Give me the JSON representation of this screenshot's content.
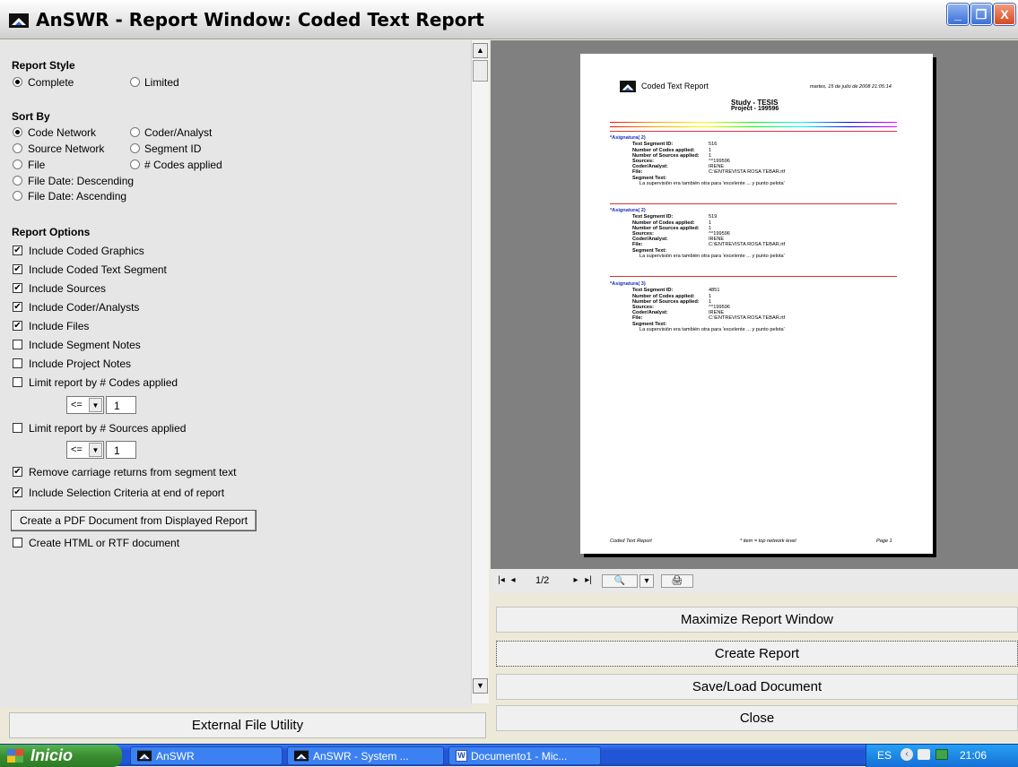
{
  "window": {
    "title": "AnSWR - Report Window:  Coded Text Report",
    "min_glyph": "_",
    "max_glyph": "❐",
    "close_glyph": "X"
  },
  "report_style": {
    "label": "Report Style",
    "options": [
      {
        "label": "Complete",
        "selected": true
      },
      {
        "label": "Limited",
        "selected": false
      }
    ]
  },
  "sort_by": {
    "label": "Sort By",
    "options": [
      {
        "label": "Code Network",
        "selected": true
      },
      {
        "label": "Coder/Analyst",
        "selected": false
      },
      {
        "label": "Source Network",
        "selected": false
      },
      {
        "label": "Segment ID",
        "selected": false
      },
      {
        "label": "File",
        "selected": false
      },
      {
        "label": "# Codes applied",
        "selected": false
      },
      {
        "label": "File Date: Descending",
        "selected": false
      },
      {
        "label": "File Date: Ascending",
        "selected": false
      }
    ]
  },
  "report_options": {
    "label": "Report Options",
    "checkboxes": [
      {
        "label": "Include Coded Graphics",
        "checked": true
      },
      {
        "label": "Include Coded Text Segment",
        "checked": true
      },
      {
        "label": "Include Sources",
        "checked": true
      },
      {
        "label": "Include Coder/Analysts",
        "checked": true
      },
      {
        "label": "Include Files",
        "checked": true
      },
      {
        "label": "Include Segment Notes",
        "checked": false
      },
      {
        "label": "Include Project Notes",
        "checked": false
      },
      {
        "label": "Limit report by # Codes applied",
        "checked": false
      },
      {
        "label": "Limit report by # Sources applied",
        "checked": false
      },
      {
        "label": "Remove carriage returns from segment text",
        "checked": true
      },
      {
        "label": "Include Selection Criteria at end of report",
        "checked": true
      },
      {
        "label": "Create HTML or RTF document",
        "checked": false
      }
    ],
    "codes_limit": {
      "operator": "<=",
      "value": "1"
    },
    "sources_limit": {
      "operator": "<=",
      "value": "1"
    },
    "pdf_button": "Create a PDF Document from Displayed Report",
    "check_glyph": "✔"
  },
  "external_button": "External File Utility",
  "preview": {
    "header_title": "Coded Text Report",
    "header_date": "martes, 15 de julio de 2008  21:05:14",
    "study": "Study - TESIS",
    "project": "Project - 199596",
    "entries": [
      {
        "code": "*Asignatura( 2)",
        "segment_id": "516",
        "codes": "1",
        "sources": "1",
        "source": "^^199596",
        "coder": "IRENE",
        "file": "C:\\ENTREVISTA ROSA TEBAR.rtf",
        "text": "La supervisión era también otra para 'excelente ... y punto pelota'"
      },
      {
        "code": "*Asignatura( 2)",
        "segment_id": "519",
        "codes": "1",
        "sources": "1",
        "source": "^^199596",
        "coder": "IRENE",
        "file": "C:\\ENTREVISTA ROSA TEBAR.rtf",
        "text": "La supervisión era también otra para 'excelente ... y punto pelota'"
      },
      {
        "code": "*Asignatura( 3)",
        "segment_id": "4851",
        "codes": "1",
        "sources": "1",
        "source": "^^199596",
        "coder": "IRENE",
        "file": "C:\\ENTREVISTA ROSA TEBAR.rtf",
        "text": "La supervisión era también otra para 'excelente ... y punto pelota'"
      }
    ],
    "field_labels": {
      "segment_id": "Text Segment ID:",
      "codes": "Number of Codes applied:",
      "sources": "Number of Sources applied:",
      "source": "Sources:",
      "coder": "Coder/Analyst:",
      "file": "File:",
      "text": "Segment Text:"
    },
    "footer_left": "Coded Text Report",
    "footer_mid": "* item = top network level",
    "footer_right": "Page 1"
  },
  "nav": {
    "page": "1/2",
    "first": "|◂",
    "prev": "◂",
    "next": "▸",
    "last": "▸|",
    "zoom": "🔍",
    "zoom_drop": "▾",
    "print": "🖨"
  },
  "actions": {
    "maximize": "Maximize Report Window",
    "create": "Create Report",
    "save_load": "Save/Load Document",
    "close": "Close"
  },
  "taskbar": {
    "start": "Inicio",
    "items": [
      "AnSWR",
      "AnSWR - System ...",
      "Documento1 - Mic..."
    ],
    "lang": "ES",
    "clock": "21:06"
  },
  "colors": {
    "title_gradient_top": "#ffffff",
    "preview_bg": "#808080",
    "taskbar_blue": "#2157d6",
    "start_green": "#3a8e31"
  }
}
